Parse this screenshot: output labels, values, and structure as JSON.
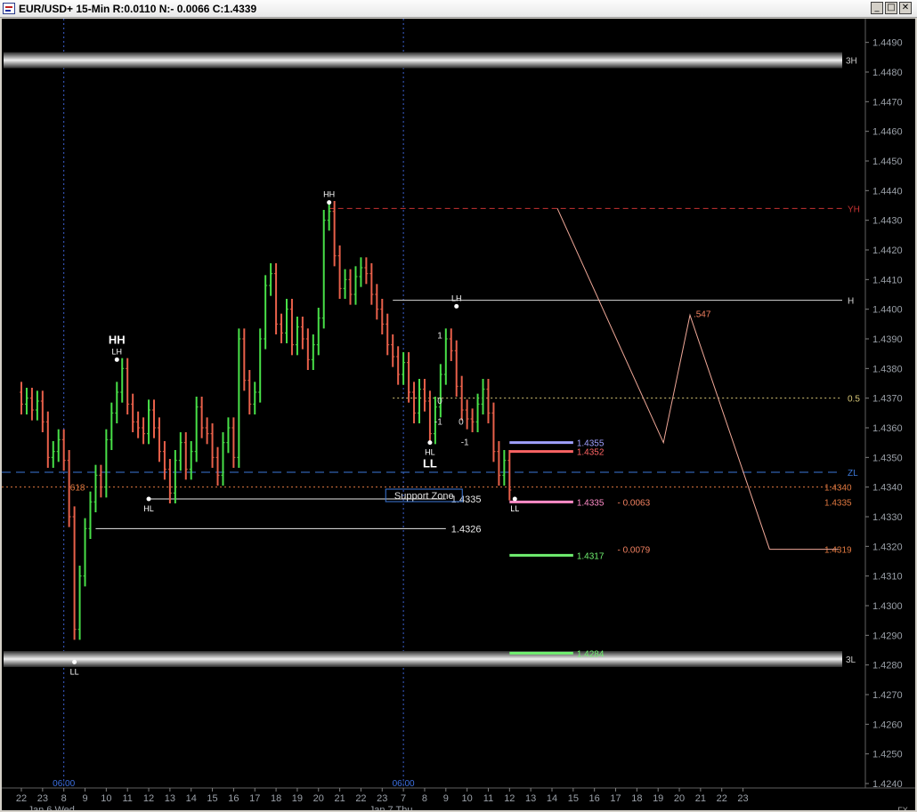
{
  "window": {
    "title": "EUR/USD+ 15-Min R:0.0110 N:- 0.0066 C:1.4339",
    "min_glyph": "_",
    "max_glyph": "□",
    "close_glyph": "✕"
  },
  "icons": {
    "app": "chart-window-icon",
    "corner": "fx-corner-label"
  },
  "colors": {
    "background": "#000000",
    "up_bar": "#48e048",
    "down_bar": "#e8604a",
    "axis_text": "#9aa0a8",
    "zl_line": "#3c78d8",
    "fib_618": "#e07840"
  },
  "chart_data": {
    "type": "ohlc",
    "symbol": "EUR/USD+",
    "timeframe": "15-Min",
    "ylim": [
      1.424,
      1.4495
    ],
    "price_axis_ticks": [
      "1.4490",
      "1.4480",
      "1.4470",
      "1.4460",
      "1.4450",
      "1.4440",
      "1.4430",
      "1.4420",
      "1.4410",
      "1.4400",
      "1.4390",
      "1.4380",
      "1.4370",
      "1.4360",
      "1.4350",
      "1.4340",
      "1.4330",
      "1.4320",
      "1.4310",
      "1.4300",
      "1.4290",
      "1.4280",
      "1.4270",
      "1.4260",
      "1.4250",
      "1.4240"
    ],
    "time_axis_ticks": [
      {
        "label": "22",
        "col": 0
      },
      {
        "label": "23",
        "col": 4
      },
      {
        "label": "8",
        "col": 8
      },
      {
        "label": "9",
        "col": 12
      },
      {
        "label": "10",
        "col": 16
      },
      {
        "label": "11",
        "col": 20
      },
      {
        "label": "12",
        "col": 24
      },
      {
        "label": "13",
        "col": 28
      },
      {
        "label": "14",
        "col": 32
      },
      {
        "label": "15",
        "col": 36
      },
      {
        "label": "16",
        "col": 40
      },
      {
        "label": "17",
        "col": 44
      },
      {
        "label": "18",
        "col": 48
      },
      {
        "label": "19",
        "col": 52
      },
      {
        "label": "20",
        "col": 56
      },
      {
        "label": "21",
        "col": 60
      },
      {
        "label": "22",
        "col": 64
      },
      {
        "label": "23",
        "col": 68
      },
      {
        "label": "7",
        "col": 72
      },
      {
        "label": "8",
        "col": 76
      },
      {
        "label": "9",
        "col": 80
      },
      {
        "label": "10",
        "col": 84
      },
      {
        "label": "11",
        "col": 88
      },
      {
        "label": "12",
        "col": 92
      },
      {
        "label": "13",
        "col": 96
      },
      {
        "label": "14",
        "col": 100
      },
      {
        "label": "15",
        "col": 104
      },
      {
        "label": "16",
        "col": 108
      },
      {
        "label": "17",
        "col": 112
      },
      {
        "label": "18",
        "col": 116
      },
      {
        "label": "19",
        "col": 120
      },
      {
        "label": "20",
        "col": 124
      },
      {
        "label": "21",
        "col": 128
      },
      {
        "label": "22",
        "col": 132
      },
      {
        "label": "23",
        "col": 136
      }
    ],
    "date_labels": [
      {
        "label": "Jan 6 Wed",
        "col": 8
      },
      {
        "label": "Jan 7 Thu",
        "col": 72
      }
    ],
    "session_markers": [
      {
        "label": "06:00",
        "col": 8
      },
      {
        "label": "06:00",
        "col": 72
      }
    ],
    "bars_open": 1.4372,
    "bar_closes": [
      1.4368,
      1.437,
      1.4366,
      1.4369,
      1.4362,
      1.435,
      1.4352,
      1.4356,
      1.4349,
      1.433,
      1.4292,
      1.431,
      1.4326,
      1.4335,
      1.4344,
      1.434,
      1.4356,
      1.4365,
      1.4372,
      1.438,
      1.4368,
      1.4362,
      1.436,
      1.4358,
      1.4366,
      1.436,
      1.4352,
      1.4346,
      1.4338,
      1.4349,
      1.4355,
      1.4346,
      1.4352,
      1.4367,
      1.436,
      1.4358,
      1.435,
      1.4344,
      1.4355,
      1.436,
      1.435,
      1.439,
      1.4376,
      1.4368,
      1.4372,
      1.439,
      1.4408,
      1.4412,
      1.4395,
      1.4392,
      1.44,
      1.4388,
      1.4394,
      1.439,
      1.4383,
      1.4388,
      1.4397,
      1.443,
      1.4433,
      1.4418,
      1.4407,
      1.441,
      1.4405,
      1.4411,
      1.4414,
      1.4412,
      1.4405,
      1.44,
      1.4395,
      1.4388,
      1.4384,
      1.4378,
      1.4382,
      1.4372,
      1.4365,
      1.4373,
      1.4369,
      1.4358,
      1.4367,
      1.4378,
      1.439,
      1.4386,
      1.4374,
      1.4366,
      1.4363,
      1.4362,
      1.4368,
      1.4373,
      1.4365,
      1.4352,
      1.4344,
      1.4349,
      1.4339
    ],
    "swing_labels": [
      {
        "text": "LL",
        "col": 10,
        "price": 1.4281,
        "pos": "below"
      },
      {
        "text": "HL",
        "col": 24,
        "price": 1.4336,
        "pos": "below"
      },
      {
        "text": "LH",
        "col": 18,
        "price": 1.4383,
        "pos": "above"
      },
      {
        "text": "HH",
        "col": 18,
        "price": 1.4383,
        "pos": "above2",
        "big": true
      },
      {
        "text": "HH",
        "col": 58,
        "price": 1.4436,
        "pos": "above"
      },
      {
        "text": "LH",
        "col": 82,
        "price": 1.4401,
        "pos": "above"
      },
      {
        "text": "HL",
        "col": 77,
        "price": 1.4355,
        "pos": "below"
      },
      {
        "text": "LL",
        "col": 77,
        "price": 1.4355,
        "pos": "below2",
        "big": true
      },
      {
        "text": "LL",
        "col": 93,
        "price": 1.4336,
        "pos": "below"
      }
    ],
    "zones": [
      {
        "label": "3H",
        "price": 1.4484
      },
      {
        "label": "3L",
        "price": 1.4282
      }
    ],
    "level_lines": [
      {
        "label": "YH",
        "price": 1.4434,
        "color": "#c83232",
        "dash": "6 4",
        "from_col": 58
      },
      {
        "label": "H",
        "price": 1.4403,
        "color": "#d8d8d8",
        "dash": "",
        "from_col": 70
      },
      {
        "label": "0.5",
        "price": 1.437,
        "color": "#d8c878",
        "dash": "2 3",
        "from_col": 70
      },
      {
        "label": "ZL",
        "price": 1.4345,
        "color": "#3c78d8",
        "dash": "10 6",
        "from_col": -5
      }
    ],
    "fib": {
      "label": ".618",
      "price": 1.434
    },
    "right_labels": [
      {
        "text": "1.4340",
        "price": 1.434,
        "color": "#e07840"
      },
      {
        "text": "1.4335",
        "price": 1.4335,
        "color": "#e07840"
      },
      {
        "text": "1.4319",
        "price": 1.4319,
        "color": "#e07840"
      }
    ],
    "support": [
      {
        "text": "1.4335",
        "price": 1.4336,
        "from_col": 24,
        "to_col": 80
      },
      {
        "text": "1.4326",
        "price": 1.4326,
        "from_col": 14,
        "to_col": 80
      }
    ],
    "support_zone_label": "Support Zone",
    "targets": [
      {
        "text": "1.4355",
        "price": 1.4355,
        "color": "#a0a0ff",
        "from_col": 92,
        "to_col": 104
      },
      {
        "text": "1.4352",
        "price": 1.4352,
        "color": "#ff6464",
        "from_col": 92,
        "to_col": 104
      },
      {
        "text": "1.4335",
        "price": 1.4335,
        "color": "#ff8cc8",
        "from_col": 92,
        "to_col": 104
      },
      {
        "text": "1.4317",
        "price": 1.4317,
        "color": "#70f070",
        "from_col": 92,
        "to_col": 104
      },
      {
        "text": "1.4284",
        "price": 1.4284,
        "color": "#70f070",
        "from_col": 92,
        "to_col": 104
      }
    ],
    "distances": [
      {
        "text": "- 0.0063",
        "price": 1.4335,
        "from_col": 113
      },
      {
        "text": "- 0.0079",
        "price": 1.4319,
        "from_col": 113
      }
    ],
    "projection": {
      "points": [
        [
          1.4434,
          101
        ],
        [
          1.4355,
          121
        ],
        [
          1.4398,
          126
        ],
        [
          1.4319,
          141
        ]
      ],
      "end_col": 154,
      "label": ".547"
    },
    "counters": [
      {
        "text": "1",
        "col": 80,
        "price": 1.4391
      },
      {
        "text": "0",
        "col": 80,
        "price": 1.4369
      },
      {
        "text": "-1",
        "col": 80,
        "price": 1.4362
      },
      {
        "text": "0",
        "col": 84,
        "price": 1.4362
      },
      {
        "text": "-1",
        "col": 85,
        "price": 1.4355
      }
    ]
  }
}
